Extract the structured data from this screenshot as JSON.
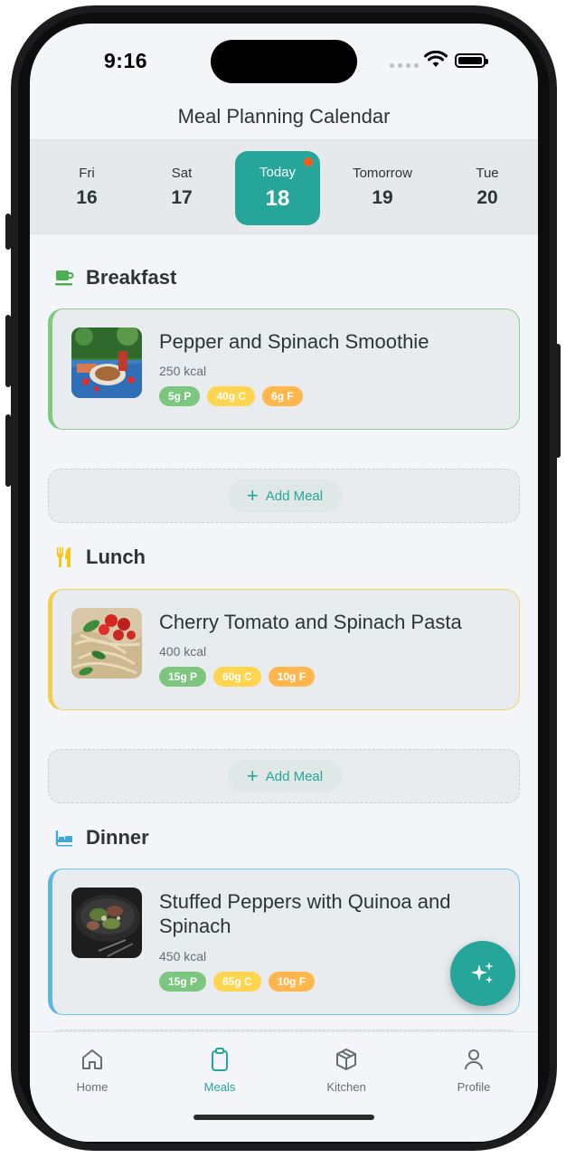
{
  "status_bar": {
    "time": "9:16"
  },
  "header": {
    "title": "Meal Planning Calendar"
  },
  "dates": [
    {
      "name": "Fri",
      "num": "16"
    },
    {
      "name": "Sat",
      "num": "17"
    },
    {
      "name": "Today",
      "num": "18",
      "active": true
    },
    {
      "name": "Tomorrow",
      "num": "19"
    },
    {
      "name": "Tue",
      "num": "20"
    }
  ],
  "sections": {
    "breakfast": {
      "title": "Breakfast",
      "icon": "coffee-cup-icon",
      "color": "#7ccc80",
      "meal": {
        "name": "Pepper and Spinach Smoothie",
        "kcal": "250 kcal",
        "protein": "5g P",
        "carbs": "40g C",
        "fat": "6g F"
      },
      "add_label": "Add Meal"
    },
    "lunch": {
      "title": "Lunch",
      "icon": "fork-knife-icon",
      "color": "#f5cd4e",
      "meal": {
        "name": "Cherry Tomato and Spinach Pasta",
        "kcal": "400 kcal",
        "protein": "15g P",
        "carbs": "60g C",
        "fat": "10g F"
      },
      "add_label": "Add Meal"
    },
    "dinner": {
      "title": "Dinner",
      "icon": "dinner-bed-icon",
      "color": "#5bb8e0",
      "meal": {
        "name": "Stuffed Peppers with Quinoa and Spinach",
        "kcal": "450 kcal",
        "protein": "15g P",
        "carbs": "65g C",
        "fat": "10g F"
      }
    }
  },
  "tabs": [
    {
      "label": "Home",
      "icon": "home-icon"
    },
    {
      "label": "Meals",
      "icon": "clipboard-icon",
      "active": true
    },
    {
      "label": "Kitchen",
      "icon": "box-icon"
    },
    {
      "label": "Profile",
      "icon": "user-icon"
    }
  ],
  "colors": {
    "accent": "#26a69a",
    "today_dot": "#ff5722"
  }
}
